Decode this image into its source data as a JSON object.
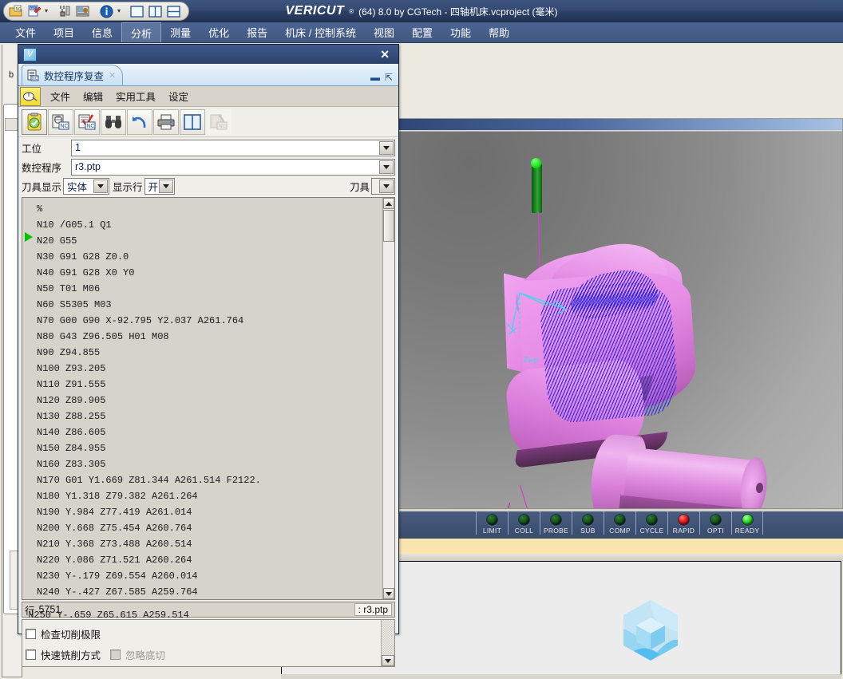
{
  "app": {
    "brand": "VERICUT",
    "brand_tm": "®",
    "title_suffix": "(64) 8.0 by CGTech - 四轴机床.vcproject (毫米)"
  },
  "quick_access": {
    "buttons": [
      {
        "name": "open-project-icon",
        "label": "打开项目"
      },
      {
        "name": "save-project-icon",
        "label": "保存项目"
      },
      {
        "name": "save-dropdown-caret",
        "label": "▾"
      },
      {
        "name": "tool-manager-icon",
        "label": "刀具管理"
      },
      {
        "name": "machine-setup-icon",
        "label": "机床设置"
      },
      {
        "name": "info-icon",
        "label": "信息"
      },
      {
        "name": "info-dropdown-caret",
        "label": "▾"
      },
      {
        "name": "single-view-icon",
        "label": "单视图"
      },
      {
        "name": "two-column-view-icon",
        "label": "双列视图"
      },
      {
        "name": "two-row-view-icon",
        "label": "双行视图"
      }
    ]
  },
  "menubar": {
    "items": [
      {
        "label": "文件",
        "active": false
      },
      {
        "label": "项目",
        "active": false
      },
      {
        "label": "信息",
        "active": false
      },
      {
        "label": "分析",
        "active": true
      },
      {
        "label": "测量",
        "active": false
      },
      {
        "label": "优化",
        "active": false
      },
      {
        "label": "报告",
        "active": false
      },
      {
        "label": "机床 / 控制系统",
        "active": false
      },
      {
        "label": "视图",
        "active": false
      },
      {
        "label": "配置",
        "active": false
      },
      {
        "label": "功能",
        "active": false
      },
      {
        "label": "帮助",
        "active": false
      }
    ]
  },
  "dialog": {
    "titlebar": {
      "icon": "V",
      "close_label": "✕"
    },
    "tab": {
      "icon_name": "nc-program-icon",
      "label": "数控程序复查",
      "close_label": "✕"
    },
    "tab_controls": {
      "minimize_label": "▬",
      "restore_label": "⇱"
    },
    "menu": {
      "items": [
        "文件",
        "编辑",
        "实用工具",
        "设定"
      ]
    },
    "toolbar": {
      "buttons": [
        {
          "name": "review-start-icon",
          "pressed": true
        },
        {
          "name": "inspect-nc-icon",
          "pressed": false
        },
        {
          "name": "check-nc-icon",
          "pressed": false
        },
        {
          "name": "find-binoculars-icon",
          "pressed": false
        },
        {
          "name": "undo-icon",
          "pressed": false
        },
        {
          "name": "print-icon",
          "pressed": false
        },
        {
          "name": "split-view-icon",
          "pressed": false
        },
        {
          "name": "compare-nc-icon",
          "pressed": false
        }
      ]
    },
    "form": {
      "station_label": "工位",
      "station_value": "1",
      "program_label": "数控程序",
      "program_value": "r3.ptp",
      "tool_display_label": "刀具显示",
      "tool_display_value": "实体",
      "show_lines_label": "显示行",
      "show_lines_value": "开",
      "tool_label": "刀具",
      "tool_value": ""
    },
    "code": {
      "lines": [
        "%",
        "N10 /G05.1 Q1",
        "N20 G55",
        "N30 G91 G28 Z0.0",
        "N40 G91 G28 X0 Y0",
        "N50 T01 M06",
        "N60 S5305 M03",
        "N70 G00 G90 X-92.795 Y2.037 A261.764",
        "N80 G43 Z96.505 H01 M08",
        "N90 Z94.855",
        "N100 Z93.205",
        "N110 Z91.555",
        "N120 Z89.905",
        "N130 Z88.255",
        "N140 Z86.605",
        "N150 Z84.955",
        "N160 Z83.305",
        "N170 G01 Y1.669 Z81.344 A261.514 F2122.",
        "N180 Y1.318 Z79.382 A261.264",
        "N190 Y.984 Z77.419 A261.014",
        "N200 Y.668 Z75.454 A260.764",
        "N210 Y.368 Z73.488 A260.514",
        "N220 Y.086 Z71.521 A260.264",
        "N230 Y-.179 Z69.554 A260.014",
        "N240 Y-.427 Z67.585 A259.764"
      ],
      "clipped_line": "N250 Y-.659 Z65.615 A259.514",
      "current_line_index": 2
    },
    "status": {
      "line_label": "行",
      "line_number": "5751",
      "file_label": ": r3.ptp"
    },
    "options": {
      "check_cut_limit": {
        "label": "检查切削极限",
        "checked": false,
        "disabled": false
      },
      "fast_mill_mode": {
        "label": "快速铣削方式",
        "checked": false,
        "disabled": false
      },
      "ignore_undercut": {
        "label": "忽略底切",
        "checked": false,
        "disabled": true
      }
    }
  },
  "viewport": {
    "axis_label": "Zwp",
    "colors": {
      "tool": "#1b8a22",
      "toolpath": "#e23ce2",
      "workpiece": "#e68ce6",
      "cut_path": "#2828eb",
      "axis": "#3fd8e8",
      "background": "#8d8d8d"
    }
  },
  "status_lights": [
    {
      "label": "LIMIT",
      "state": "off"
    },
    {
      "label": "COLL",
      "state": "off"
    },
    {
      "label": "PROBE",
      "state": "off"
    },
    {
      "label": "SUB",
      "state": "off"
    },
    {
      "label": "COMP",
      "state": "off"
    },
    {
      "label": "CYCLE",
      "state": "off"
    },
    {
      "label": "RAPID",
      "state": "red"
    },
    {
      "label": "OPTI",
      "state": "off"
    },
    {
      "label": "READY",
      "state": "green"
    }
  ],
  "background_panel": {
    "tree_tab_label": "b"
  }
}
